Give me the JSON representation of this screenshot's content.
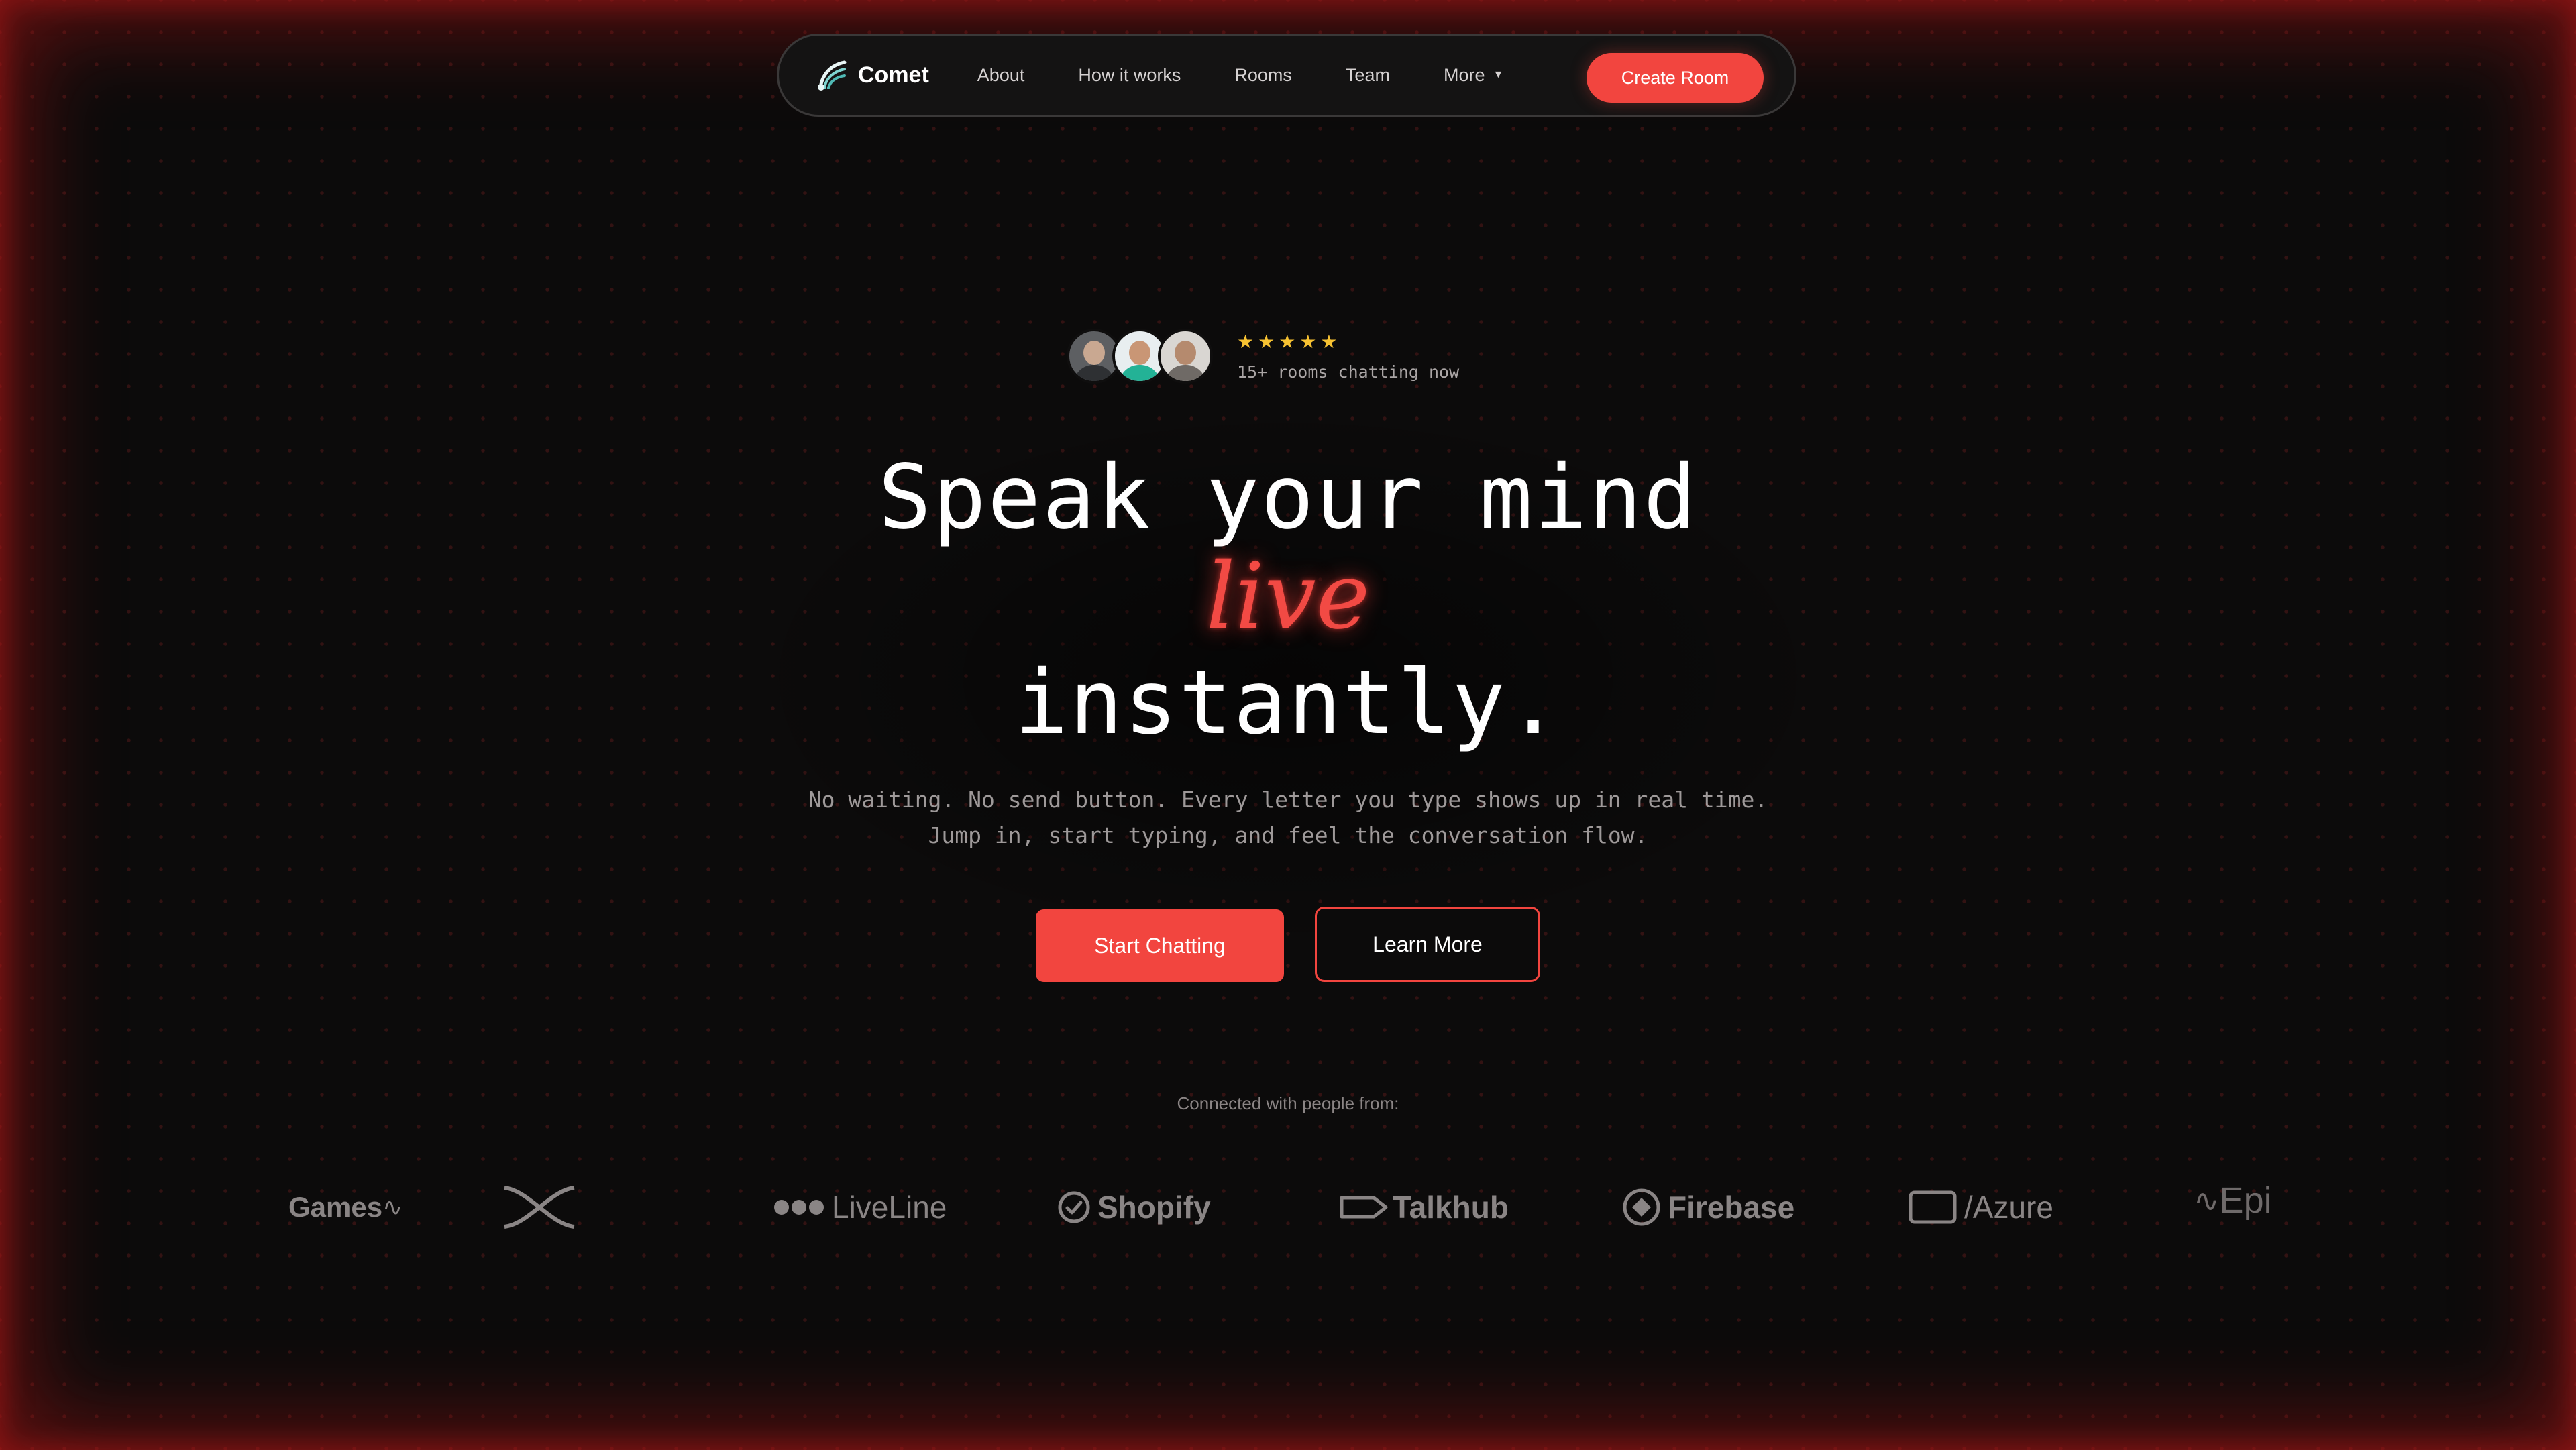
{
  "nav": {
    "brand": "Comet",
    "links": [
      "About",
      "How it works",
      "Rooms",
      "Team",
      "More"
    ],
    "cta": "Create Room"
  },
  "proof": {
    "stars": "★★★★★",
    "rating_stars": 5,
    "caption": "15+ rooms chatting now"
  },
  "hero": {
    "line1": "Speak your mind",
    "line2": "live",
    "line3": "instantly.",
    "sub1": "No waiting. No send button. Every letter you type shows up in real time.",
    "sub2": "Jump in, start typing, and feel the conversation flow.",
    "primary_cta": "Start Chatting",
    "secondary_cta": "Learn More"
  },
  "logos": {
    "caption": "Connected with people from:",
    "items": [
      "Games",
      "LiveLine",
      "Shopify",
      "Talkhub",
      "Firebase",
      "/Azure",
      "Epi"
    ]
  },
  "colors": {
    "accent": "#f2453f",
    "background": "#0c0b0b",
    "star": "#f7c232",
    "logo_gray": "#8a8585"
  }
}
